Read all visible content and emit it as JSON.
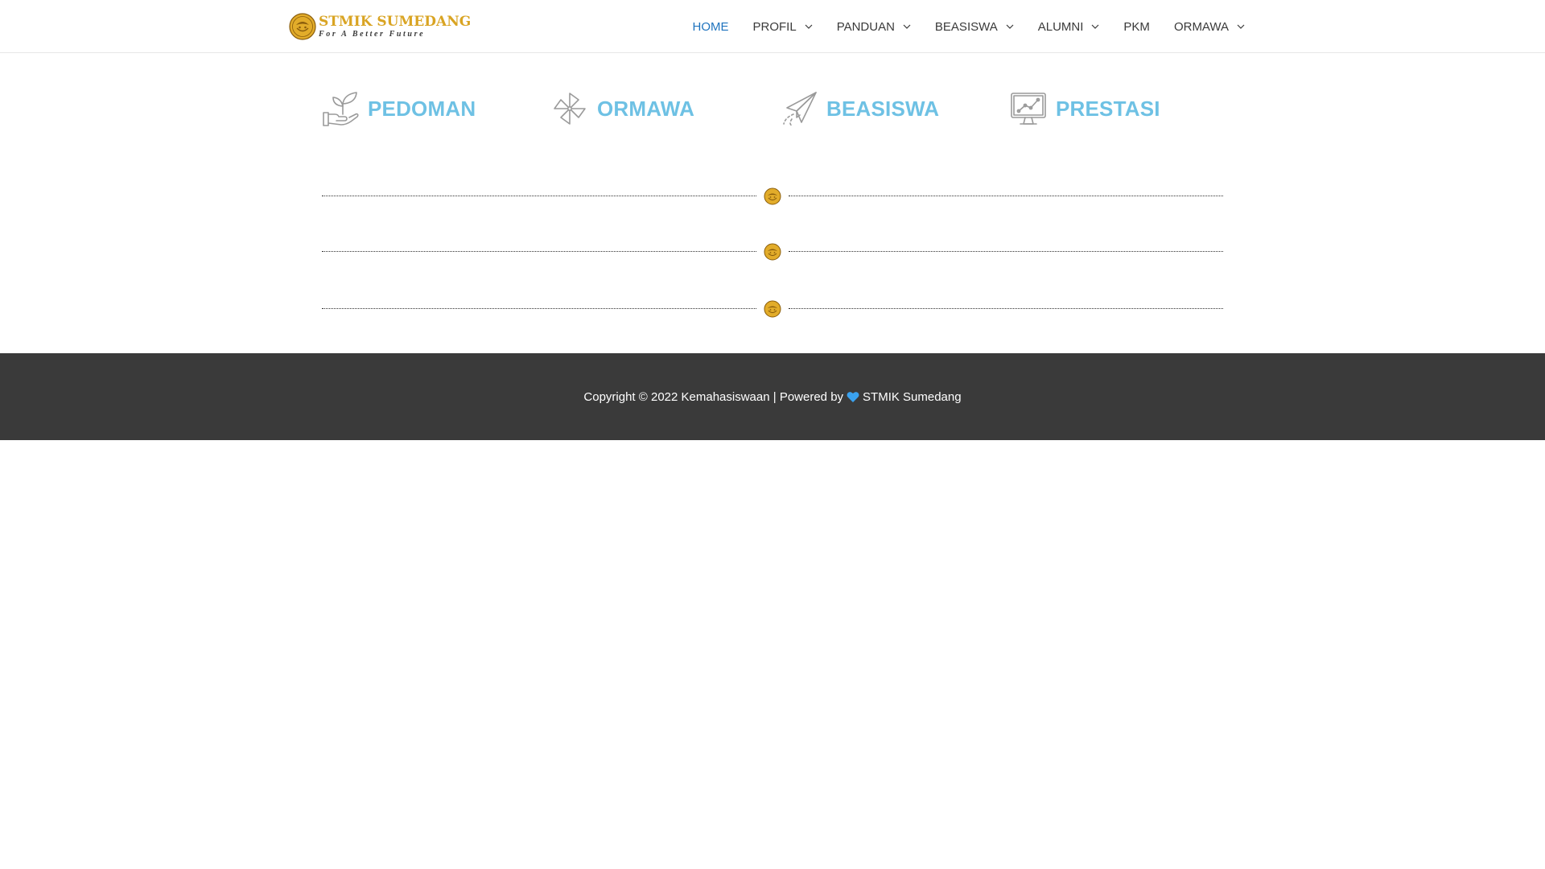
{
  "header": {
    "logo_title": "STMIK SUMEDANG",
    "logo_tagline": "For A Better Future",
    "nav": [
      {
        "label": "HOME",
        "active": true,
        "dropdown": false
      },
      {
        "label": "PROFIL",
        "active": false,
        "dropdown": true
      },
      {
        "label": "PANDUAN",
        "active": false,
        "dropdown": true
      },
      {
        "label": "BEASISWA",
        "active": false,
        "dropdown": true
      },
      {
        "label": "ALUMNI",
        "active": false,
        "dropdown": true
      },
      {
        "label": "PKM",
        "active": false,
        "dropdown": false
      },
      {
        "label": "ORMAWA",
        "active": false,
        "dropdown": true
      }
    ]
  },
  "features": [
    {
      "label": "PEDOMAN",
      "icon": "hand-plant-icon"
    },
    {
      "label": "ORMAWA",
      "icon": "pinwheel-icon"
    },
    {
      "label": "BEASISWA",
      "icon": "paper-plane-icon"
    },
    {
      "label": "PRESTASI",
      "icon": "monitor-chart-icon"
    }
  ],
  "footer": {
    "copyright": "Copyright © 2022 Kemahasiswaan | Powered by",
    "powered_by": "STMIK Sumedang"
  },
  "colors": {
    "accent": "#1e73be",
    "feature": "#6ec1e4",
    "logo_gold": "#d9a423",
    "footer_bg": "#3a3a3a",
    "heart": "#3aa2ef"
  }
}
